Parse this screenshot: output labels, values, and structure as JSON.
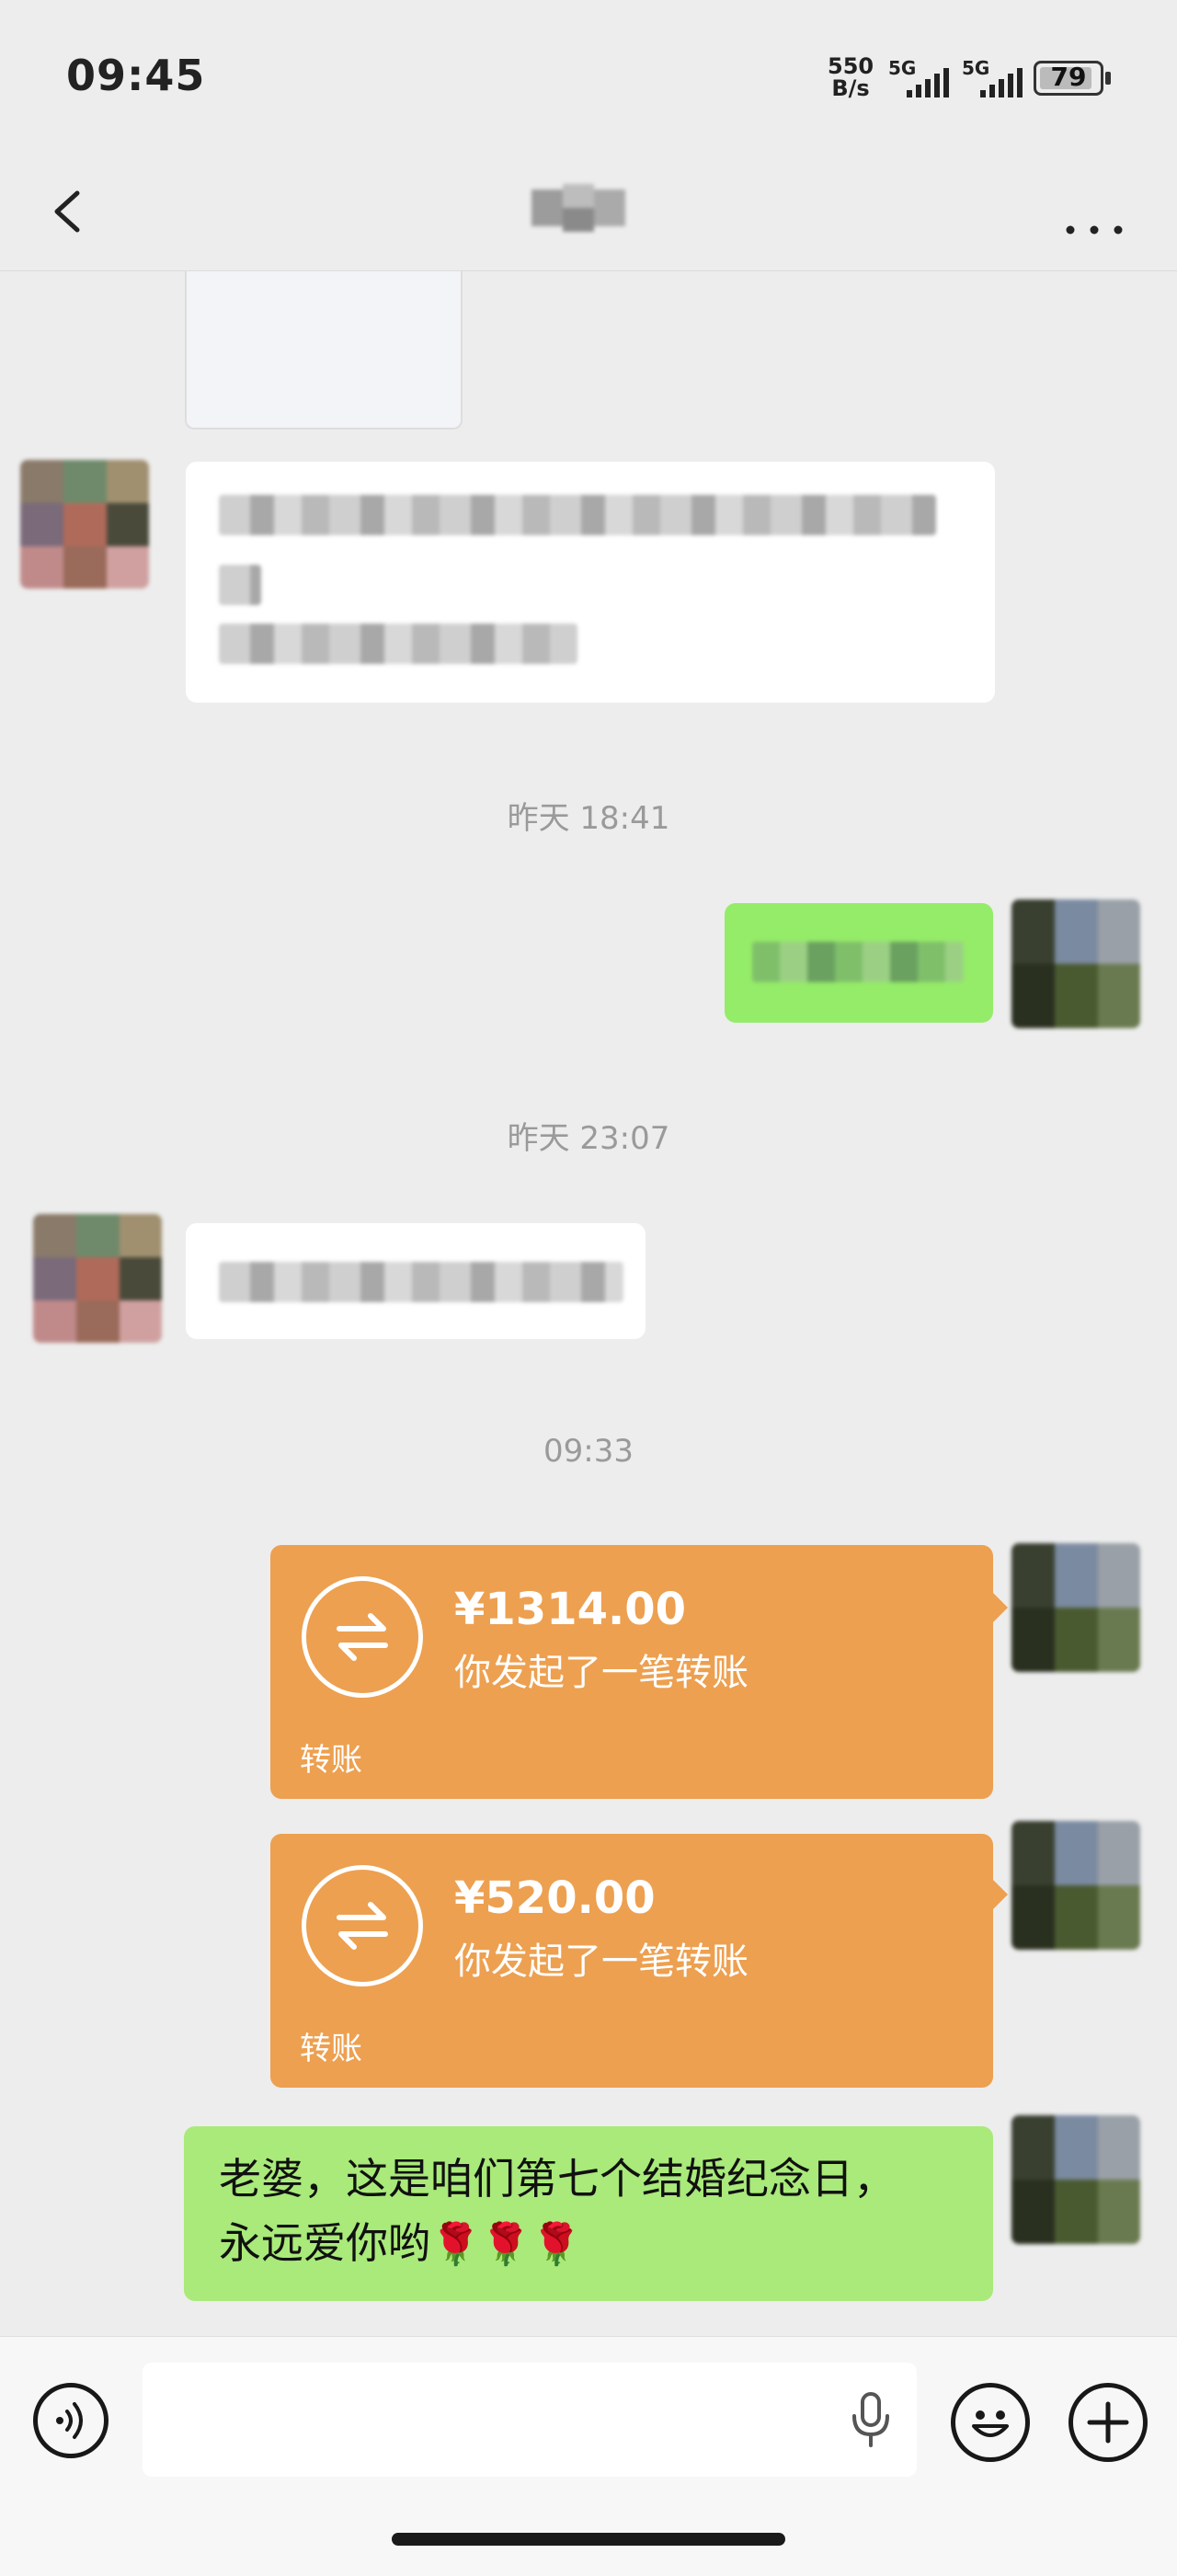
{
  "status_bar": {
    "time": "09:45",
    "net_speed_value": "550",
    "net_speed_unit": "B/s",
    "signal_1": "5G",
    "signal_2": "5G",
    "battery": "79"
  },
  "nav": {
    "back_icon": "chevron-left-icon",
    "more_icon": "more-dots-icon"
  },
  "timestamps": [
    "昨天 18:41",
    "昨天 23:07",
    "09:33"
  ],
  "transfers": [
    {
      "amount": "¥1314.00",
      "desc": "你发起了一笔转账",
      "label": "转账"
    },
    {
      "amount": "¥520.00",
      "desc": "你发起了一笔转账",
      "label": "转账"
    }
  ],
  "last_message": {
    "line1": "老婆，这是咱们第七个结婚纪念日，",
    "line2": "永远爱你哟",
    "emoji": "🌹🌹🌹"
  },
  "input_bar": {
    "voice_icon": "voice-icon",
    "mic_icon": "microphone-icon",
    "emoji_icon": "emoji-icon",
    "plus_icon": "plus-icon"
  },
  "colors": {
    "background": "#EDEDED",
    "self_bubble": "#95EC69",
    "transfer": "#EDA050"
  }
}
